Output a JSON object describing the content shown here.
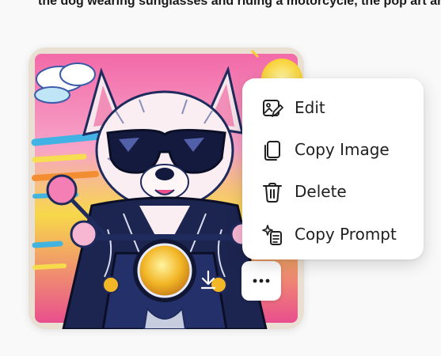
{
  "header": {
    "cut_off_text": "the dog wearing sunglasses and riding a motorcycle, the pop art and comic style"
  },
  "image_card": {
    "download_icon": "download-icon",
    "more_label": "···"
  },
  "context_menu": {
    "items": [
      {
        "label": "Edit",
        "icon": "edit-image-icon"
      },
      {
        "label": "Copy Image",
        "icon": "copy-icon"
      },
      {
        "label": "Delete",
        "icon": "trash-icon"
      },
      {
        "label": "Copy Prompt",
        "icon": "copy-prompt-sparkle-icon"
      }
    ]
  },
  "colors": {
    "background": "#f9f9f9",
    "menu_background": "#ffffff",
    "text": "#1f1f1f",
    "art_pink": "#f0529c",
    "art_yellow": "#f7d84a",
    "art_blue": "#2a3f8f"
  }
}
